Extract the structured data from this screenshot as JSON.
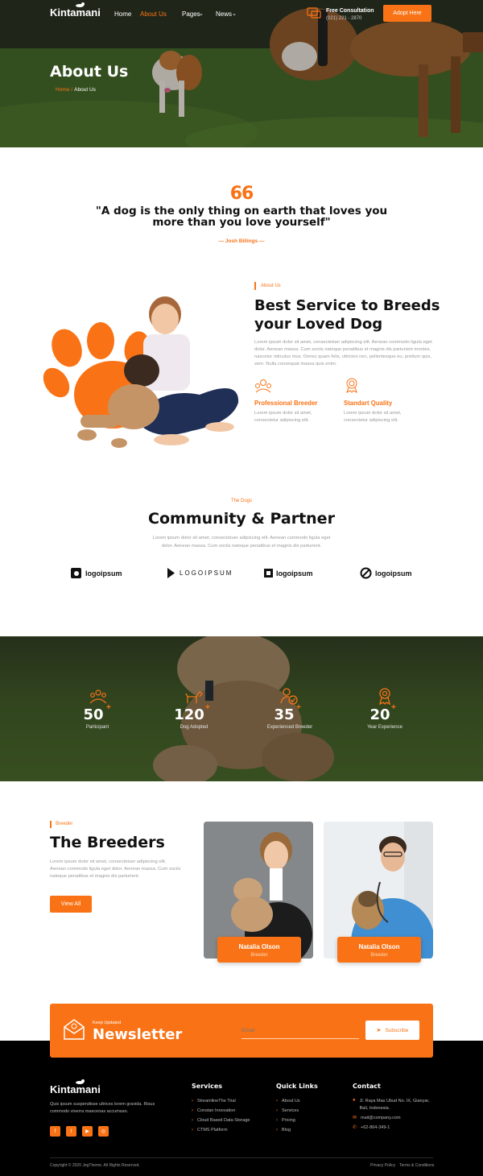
{
  "brand": {
    "name": "Kintamani",
    "accent": "#f97316"
  },
  "nav": {
    "items": [
      {
        "label": "Home"
      },
      {
        "label": "About Us"
      },
      {
        "label": "Pages"
      },
      {
        "label": "News"
      }
    ],
    "consult_title": "Free Consultation",
    "consult_phone": "(021) 221 - 2870",
    "cta": "Adopt Here"
  },
  "hero": {
    "title": "About Us",
    "crumb_home": "Home",
    "crumb_sep": "/",
    "crumb_current": "About Us"
  },
  "quote": {
    "mark": "66",
    "line1": "\"A dog is the only thing on earth that loves you",
    "line2": "more than you love yourself\"",
    "author": "— Josh Billings —"
  },
  "about": {
    "tag": "About Us",
    "title_line1": "Best Service to Breeds",
    "title_line2": "your Loved Dog",
    "body": "Lorem ipsum dolor sit amet, consectetuer adipiscing elit. Aenean commodo ligula eget dolor. Aenean massa. Cum sociis natoque penatibus et magnis dis parturient montes, nascetur ridiculus mus. Donec quam felis, ultricies nec, pellentesque eu, pretium quis, sem. Nulla consequat massa quis enim.",
    "features": [
      {
        "title": "Professional Breeder",
        "text": "Lorem ipsum dolor sit amet, consectetur adipiscing elit.",
        "icon": "breeder-icon"
      },
      {
        "title": "Standart Quality",
        "text": "Lorem ipsum dolor sit amet, consectetur adipiscing elit.",
        "icon": "quality-badge-icon"
      }
    ]
  },
  "partners": {
    "tag": "The Dogs",
    "title": "Community & Partner",
    "body_line1": "Lorem ipsum dolor sit amet, consectetuer adipiscing elit. Aenean commodo ligula eget",
    "body_line2": "dolor. Aenean massa. Cum sociis natoque penatibus et magnis dis parturient.",
    "logos": [
      "logoipsum",
      "LOGOIPSUM",
      "logoipsum",
      "logoipsum"
    ]
  },
  "stats": [
    {
      "value": "50",
      "plus": "+",
      "label": "Participant",
      "icon": "group-icon"
    },
    {
      "value": "120",
      "plus": "+",
      "label": "Dog Adopted",
      "icon": "dog-icon"
    },
    {
      "value": "35",
      "plus": "+",
      "label": "Experienced Breeder",
      "icon": "person-check-icon"
    },
    {
      "value": "20",
      "plus": "+",
      "label": "Year Experience",
      "icon": "medal-icon"
    }
  ],
  "breeders": {
    "tag": "Breeder",
    "title": "The Breeders",
    "body": "Lorem ipsum dolor sit amet, consectetuer adipiscing elit. Aenean commodo ligula eget dolor. Aenean massa. Cum sociis natoque penatibus et magnis dis parturient.",
    "button": "View All",
    "cards": [
      {
        "name": "Natalia Olson",
        "role": "Breeder"
      },
      {
        "name": "Natalia Olson",
        "role": "Breeder"
      }
    ]
  },
  "newsletter": {
    "kicker": "Keep Updated",
    "title": "Newsletter",
    "placeholder": "Email",
    "button": "Subscribe"
  },
  "footer": {
    "about": "Quis ipsum suspendisse ultrices lorem gravida. Risus commodo viverra maecenas accumsan.",
    "services_title": "Services",
    "services": [
      "StreamlineThe Trial",
      "Constan Innovation",
      "Cloud Based Data Storage",
      "CTMS Platform"
    ],
    "links_title": "Quick Links",
    "links": [
      "About Us",
      "Services",
      "Pricing",
      "Blog"
    ],
    "contact_title": "Contact",
    "address": "Jl. Raya Mas Ubud No. IX, Gianyar, Bali, Indonesia.",
    "email": "mail@company.com",
    "phone": "+62-864-349-1",
    "copyright": "Copyright © 2020 JegTheme. All Rights Reserved.",
    "privacy": "Privacy Policy",
    "terms": "Terms & Conditions"
  }
}
